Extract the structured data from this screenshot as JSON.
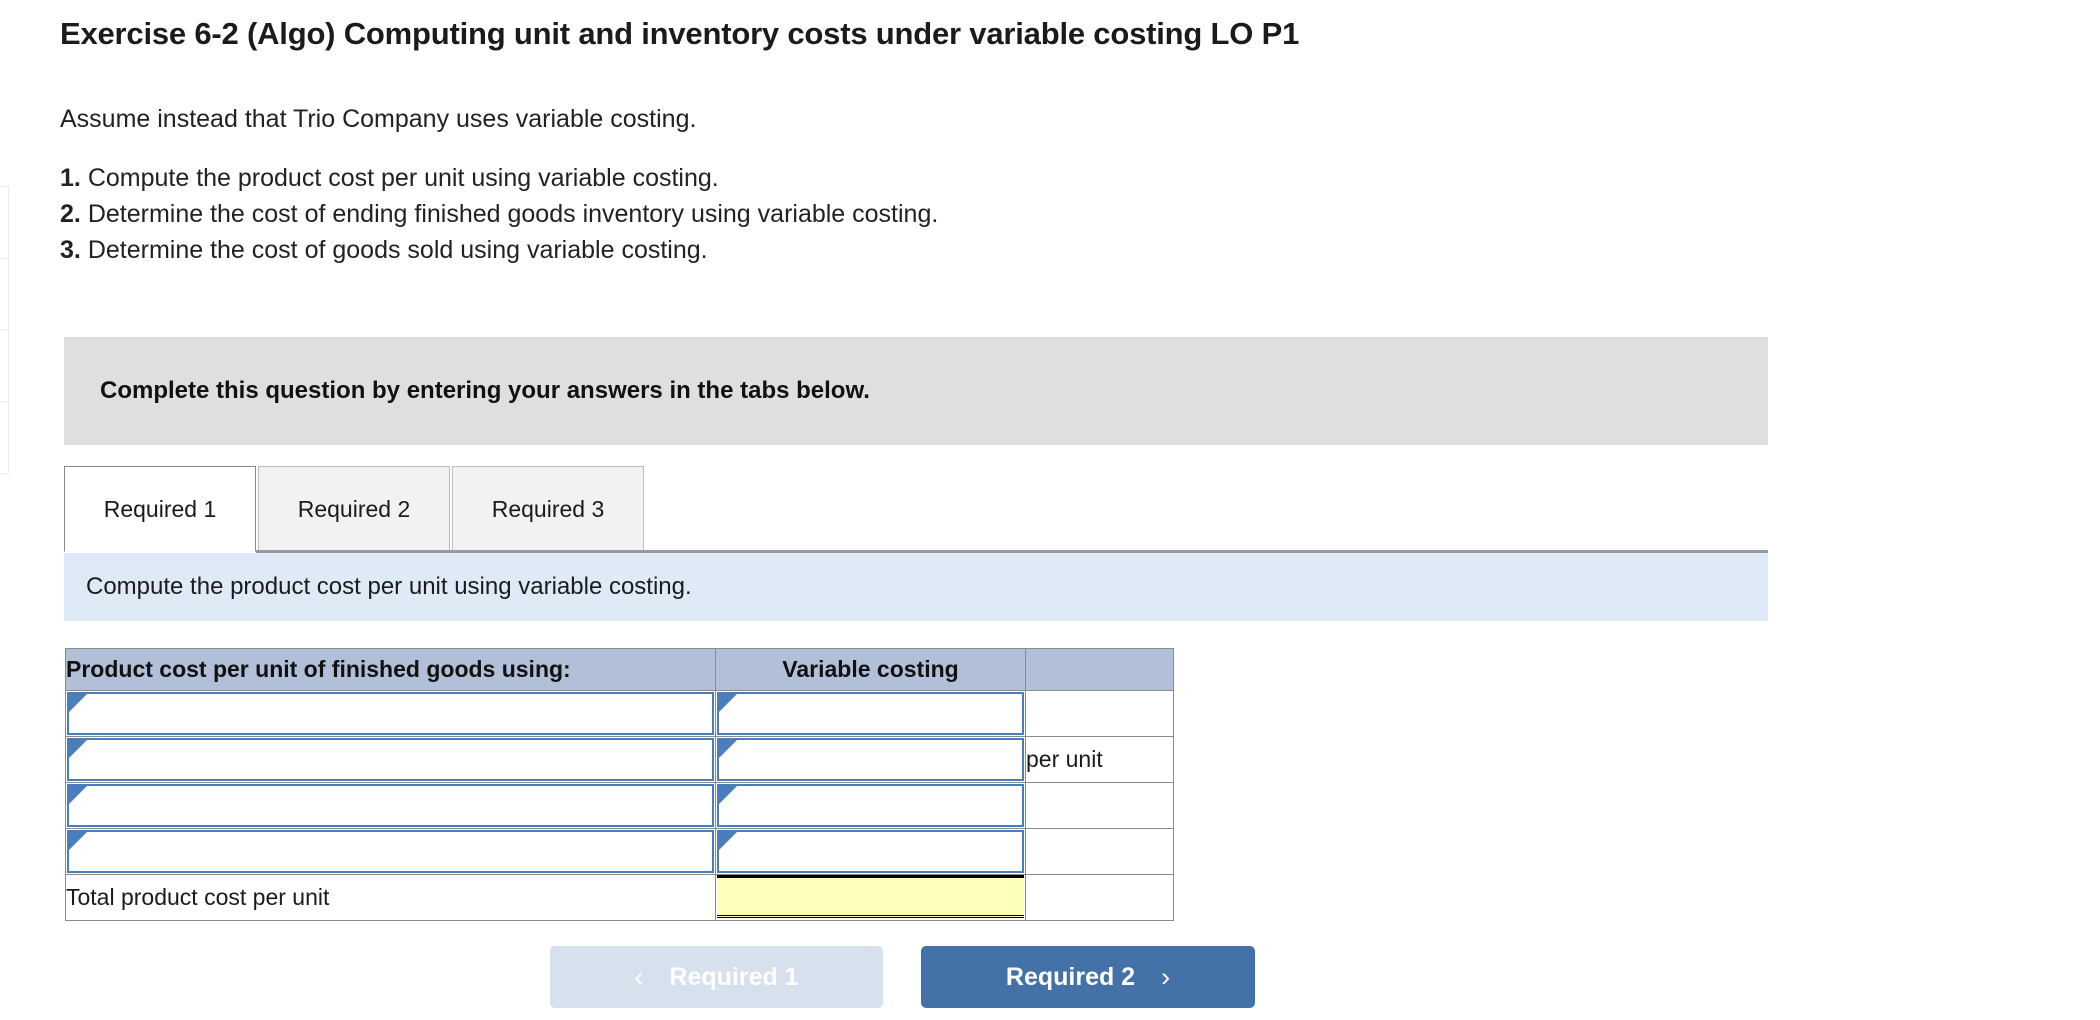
{
  "exercise": {
    "title": "Exercise 6-2 (Algo) Computing unit and inventory costs under variable costing LO P1",
    "intro": "Assume instead that Trio Company uses variable costing.",
    "requirements": [
      {
        "num": "1.",
        "text": "Compute the product cost per unit using variable costing."
      },
      {
        "num": "2.",
        "text": "Determine the cost of ending finished goods inventory using variable costing."
      },
      {
        "num": "3.",
        "text": "Determine the cost of goods sold using variable costing."
      }
    ]
  },
  "callout": {
    "text": "Complete this question by entering your answers in the tabs below."
  },
  "tabs": {
    "items": [
      {
        "label": "Required 1",
        "active": true
      },
      {
        "label": "Required 2",
        "active": false
      },
      {
        "label": "Required 3",
        "active": false
      }
    ]
  },
  "prompt": {
    "text": "Compute the product cost per unit using variable costing."
  },
  "table": {
    "headers": {
      "label": "Product cost per unit of finished goods using:",
      "value": "Variable costing",
      "blank": ""
    },
    "rows": [
      {
        "label": "",
        "value": "",
        "unit": "",
        "type": "dropdown"
      },
      {
        "label": "",
        "value": "",
        "unit": "per unit",
        "type": "dropdown"
      },
      {
        "label": "",
        "value": "",
        "unit": "",
        "type": "dropdown"
      },
      {
        "label": "",
        "value": "",
        "unit": "",
        "type": "dropdown"
      }
    ],
    "total_row": {
      "label": "Total product cost per unit",
      "value": "",
      "unit": ""
    }
  },
  "nav": {
    "prev_label": "Required 1",
    "next_label": "Required 2",
    "prev_icon": "chevron-left-icon",
    "next_icon": "chevron-right-icon",
    "prev_glyph": "‹",
    "next_glyph": "›"
  },
  "colors": {
    "callout_bg": "#dfdfdf",
    "prompt_bg": "#deeaf6",
    "table_header_bg": "#b2bfd9",
    "input_border": "#4a7ebb",
    "total_highlight": "#feffb8",
    "btn_primary": "#4471a8",
    "btn_disabled": "#d7e1ee"
  }
}
